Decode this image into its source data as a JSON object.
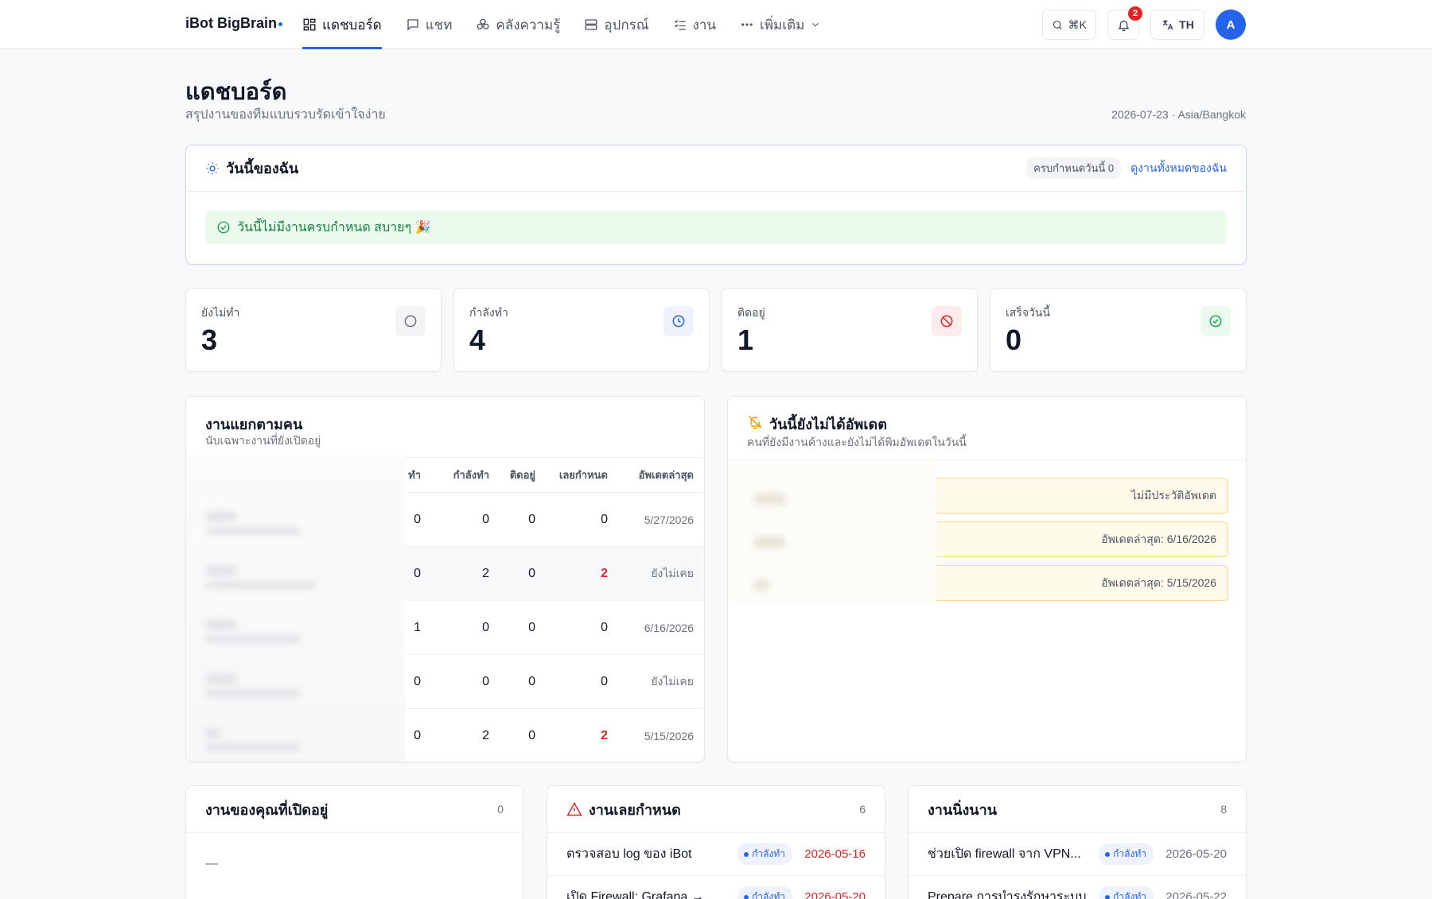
{
  "app": {
    "brand": "iBot BigBrain"
  },
  "nav": [
    {
      "label": "แดชบอร์ด",
      "icon": "dashboard-icon",
      "active": true
    },
    {
      "label": "แชท",
      "icon": "chat-icon"
    },
    {
      "label": "คลังความรู้",
      "icon": "knowledge-icon"
    },
    {
      "label": "อุปกรณ์",
      "icon": "server-icon"
    },
    {
      "label": "งาน",
      "icon": "tasks-icon"
    },
    {
      "label": "เพิ่มเติม",
      "icon": "more-icon"
    }
  ],
  "topbar": {
    "search_shortcut": "⌘K",
    "notifications": "2",
    "lang": "TH",
    "avatar": "A"
  },
  "header": {
    "title": "แดชบอร์ด",
    "subtitle": "สรุปงานของทีมแบบรวบรัดเข้าใจง่าย",
    "date": "2026-07-23 · Asia/Bangkok"
  },
  "today": {
    "title": "วันนี้ของฉัน",
    "due_pill": "ครบกำหนดวันนี้ 0",
    "view_all": "ดูงานทั้งหมดของฉัน",
    "message": "วันนี้ไม่มีงานครบกำหนด สบายๆ 🎉"
  },
  "stats": [
    {
      "label": "ยังไม่ทำ",
      "value": "3",
      "icon": "circle-icon",
      "color": "#6b7280",
      "bg": "#f3f4f6"
    },
    {
      "label": "กำลังทำ",
      "value": "4",
      "icon": "clock-icon",
      "color": "#2563eb",
      "bg": "#eef2ff"
    },
    {
      "label": "ติดอยู่",
      "value": "1",
      "icon": "blocked-icon",
      "color": "#dc2626",
      "bg": "#fdeceb"
    },
    {
      "label": "เสร็จวันนี้",
      "value": "0",
      "icon": "check-circle-icon",
      "color": "#16a34a",
      "bg": "#eafbee"
    }
  ],
  "people": {
    "title": "งานแยกตามคน",
    "subtitle": "นับเฉพาะงานที่ยังเปิดอยู่",
    "columns": [
      "ทำ",
      "กำลังทำ",
      "ติดอยู่",
      "เลยกำหนด",
      "อัพเดตล่าสุด"
    ],
    "rows": [
      {
        "todo": "0",
        "doing": "0",
        "blocked": "0",
        "overdue": "0",
        "updated": "5/27/2026"
      },
      {
        "todo": "0",
        "doing": "2",
        "blocked": "0",
        "overdue": "2",
        "updated": "ยังไม่เคย"
      },
      {
        "todo": "1",
        "doing": "0",
        "blocked": "0",
        "overdue": "0",
        "updated": "6/16/2026"
      },
      {
        "todo": "0",
        "doing": "0",
        "blocked": "0",
        "overdue": "0",
        "updated": "ยังไม่เคย"
      },
      {
        "todo": "0",
        "doing": "2",
        "blocked": "0",
        "overdue": "2",
        "updated": "5/15/2026"
      }
    ]
  },
  "not_updated": {
    "title": "วันนี้ยังไม่ได้อัพเดต",
    "subtitle": "คนที่ยังมีงานค้างและยังไม่ได้พิมอัพเดตในวันนี้",
    "rows": [
      "ไม่มีประวัติอัพเดต",
      "อัพเดตล่าสุด: 6/16/2026",
      "อัพเดตล่าสุด: 5/15/2026"
    ]
  },
  "my_open": {
    "title": "งานของคุณที่เปิดอยู่",
    "count": "0",
    "empty": "—"
  },
  "overdue": {
    "title": "งานเลยกำหนด",
    "count": "6",
    "rows": [
      {
        "text": "ตรวจสอบ log ของ iBot",
        "status": "กำลังทำ",
        "date": "2026-05-16"
      },
      {
        "text": "เปิด Firewall: Grafana →",
        "status": "กำลังทำ",
        "date": "2026-05-20"
      }
    ]
  },
  "stale": {
    "title": "งานนิ่งนาน",
    "count": "8",
    "rows": [
      {
        "text": "ช่วยเปิด firewall จาก VPN...",
        "status": "กำลังทำ",
        "date": "2026-05-20"
      },
      {
        "text": "Prepare การบำรุงรักษาระบบ",
        "status": "กำลังทำ",
        "date": "2026-05-22"
      }
    ]
  }
}
